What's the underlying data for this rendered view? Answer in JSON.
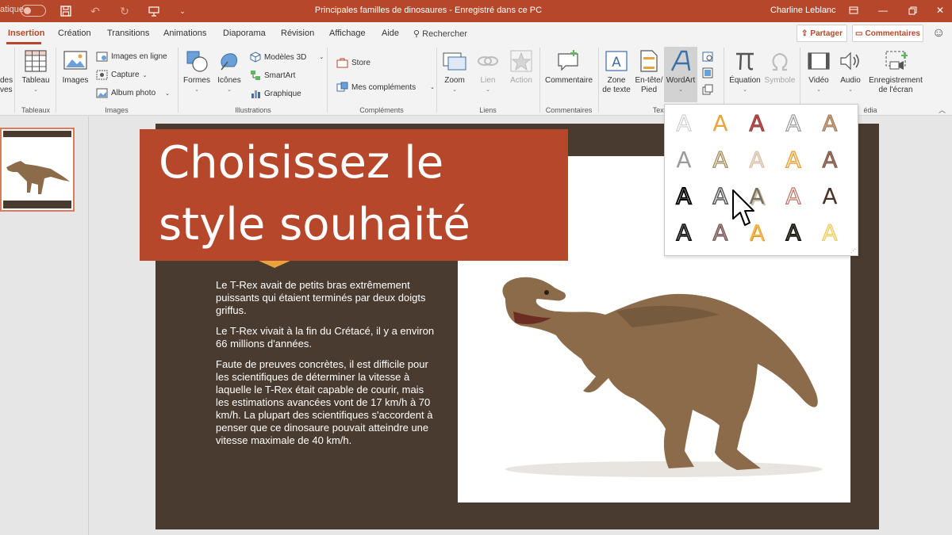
{
  "titlebar": {
    "autosave_label": "atique",
    "doc_title": "Principales familles de dinosaures  -  Enregistré dans ce PC",
    "user_name": "Charline Leblanc"
  },
  "tabs": [
    "Insertion",
    "Création",
    "Transitions",
    "Animations",
    "Diaporama",
    "Révision",
    "Affichage",
    "Aide"
  ],
  "search": {
    "label": "Rechercher"
  },
  "header_buttons": {
    "share": "Partager",
    "comments": "Commentaires"
  },
  "ribbon": {
    "groups": {
      "tableaux": "Tableaux",
      "images": "Images",
      "illustrations": "Illustrations",
      "complements": "Compléments",
      "liens": "Liens",
      "commentaires": "Commentaires",
      "texte": "Text",
      "media": "édia"
    },
    "cut_label_1": "des",
    "cut_label_2": "ves",
    "tableau": "Tableau",
    "images": "Images",
    "images_en_ligne": "Images en ligne",
    "capture": "Capture",
    "album_photo": "Album photo",
    "formes": "Formes",
    "icones": "Icônes",
    "modeles_3d": "Modèles 3D",
    "smartart": "SmartArt",
    "graphique": "Graphique",
    "store": "Store",
    "mes_complements": "Mes compléments",
    "zoom": "Zoom",
    "lien": "Lien",
    "action": "Action",
    "commentaire": "Commentaire",
    "zone_de_texte": [
      "Zone",
      "de texte"
    ],
    "en_tete_pied": [
      "En-tête/",
      "Pied"
    ],
    "wordart": "WordArt",
    "equation": "Équation",
    "symbole": "Symbole",
    "video": "Vidéo",
    "audio": "Audio",
    "enregistrement": [
      "Enregistrement",
      "de l'écran"
    ]
  },
  "slide": {
    "title": "Choisissez le style souhaité",
    "paragraphs": [
      "Le T-Rex avait de petits bras extrêmement puissants qui étaient terminés par deux doigts griffus.",
      "Le T-Rex vivait à la fin du Crétacé, il y a environ 66 millions d'années.",
      "Faute de preuves concrètes, il est difficile pour les scientifiques de déterminer la vitesse à laquelle le T-Rex était capable de courir, mais les estimations avancées vont de 17 km/h à 70 km/h. La plupart des scientifiques s'accordent à penser que ce dinosaure pouvait atteindre une vitesse maximale de 40 km/h."
    ]
  },
  "wordart_gallery": {
    "glyph": "A",
    "styles": [
      "outline-light",
      "gold-fill",
      "red-gradient",
      "outline-gray",
      "tan-gradient",
      "gray-fill",
      "gold-gradient",
      "beige-fill",
      "gold-outline",
      "brown-gradient",
      "white-black-outline",
      "white-gray-outline",
      "olive-shadow",
      "pink-outline",
      "dark-brown-fill",
      "pattern-black",
      "pink-brown",
      "orange-gradient",
      "pattern-gold",
      "light-gold"
    ]
  },
  "colors": {
    "accent": "#b7472a",
    "slide_background": "#4a3b30",
    "title_box": "#b7472a",
    "accent_triangle": "#e8a33c"
  }
}
